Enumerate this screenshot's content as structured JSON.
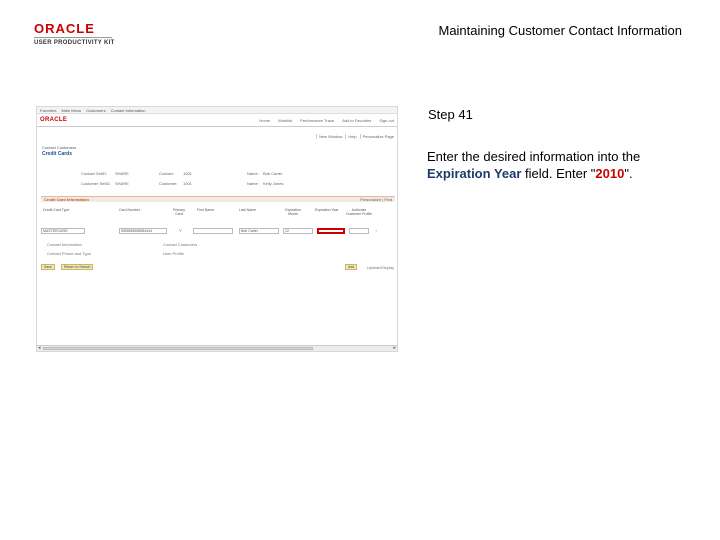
{
  "header": {
    "logo_brand": "ORACLE",
    "logo_product": "USER PRODUCTIVITY KIT",
    "title": "Maintaining Customer Contact Information"
  },
  "step": {
    "label": "Step 41",
    "instruction_prefix": "Enter the desired information into the ",
    "field_name": "Expiration Year",
    "instruction_middle": " field. Enter \"",
    "value": "2010",
    "instruction_suffix": "\"."
  },
  "colors": {
    "accent_red": "#c00000",
    "field_blue": "#1f3b6b",
    "grid_header": "#b45c2c"
  },
  "screenshot": {
    "topnav": [
      "Favorites",
      "Main Menu",
      "Customers",
      "Contact Information"
    ],
    "brand": "ORACLE",
    "menu_links": [
      "Home",
      "Worklist",
      "Performance Trace",
      "Add to Favorites",
      "Sign out"
    ],
    "utility_links": [
      "New Window",
      "Help",
      "Personalize Page"
    ],
    "breadcrumb": "Contact Customers",
    "page_title": "Credit Cards",
    "info": [
      {
        "label": "Contact SetID:",
        "value": "SHARE"
      },
      {
        "label": "Contact:",
        "value": "1001"
      },
      {
        "label": "Name:",
        "value": "Bob Carter"
      },
      {
        "label": "Customer SetID:",
        "value": "SHARE"
      },
      {
        "label": "Customer:",
        "value": "1001"
      },
      {
        "label": "Name:",
        "value": "Kelly Jones"
      }
    ],
    "grid_title": "Credit Card Information",
    "grid_pager": "Personalize | Find",
    "columns": [
      "Credit Card Type",
      "Card Number",
      "Primary Card",
      "First Name",
      "Last Name",
      "Expiration Month",
      "Expiration Year",
      "Authorize Customer Profile"
    ],
    "row": {
      "card_type": "MASTERCARD",
      "card_number": "5555555555554444",
      "primary": "Y",
      "first_name": "",
      "last_name": "Bob Carter",
      "exp_month": "12",
      "exp_year": "",
      "profile": ""
    },
    "links_left": [
      "Contact Information",
      "Contact Phone and Type"
    ],
    "links_right": [
      "Contact Customers",
      "User Profile"
    ],
    "buttons_left": [
      "Save",
      "Return to Search"
    ],
    "buttons_right": [
      "Add",
      "Update/Display"
    ]
  }
}
